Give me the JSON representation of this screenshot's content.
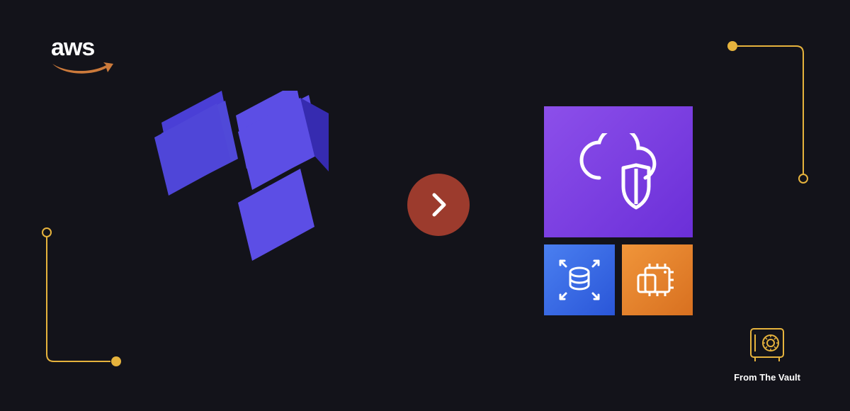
{
  "logo": {
    "aws_text": "aws",
    "swoosh_color": "#cc7a3b"
  },
  "decor": {
    "circuit_color": "#e6b33d"
  },
  "terraform": {
    "primary_color": "#5c4ee5",
    "shadow_color": "#3b2fb8"
  },
  "arrow": {
    "bg_color": "#9c3b2d",
    "chevron_color": "#ffffff"
  },
  "service_tiles": {
    "cloud_security_tile": {
      "icon_name": "cloud-shield-icon",
      "bg_gradient": "purple"
    },
    "database_tile": {
      "icon_name": "database-scale-icon",
      "bg_gradient": "blue"
    },
    "compute_tile": {
      "icon_name": "chip-icon",
      "bg_gradient": "orange"
    }
  },
  "vault_badge": {
    "label": "From The Vault",
    "icon_color": "#e6b33d"
  }
}
